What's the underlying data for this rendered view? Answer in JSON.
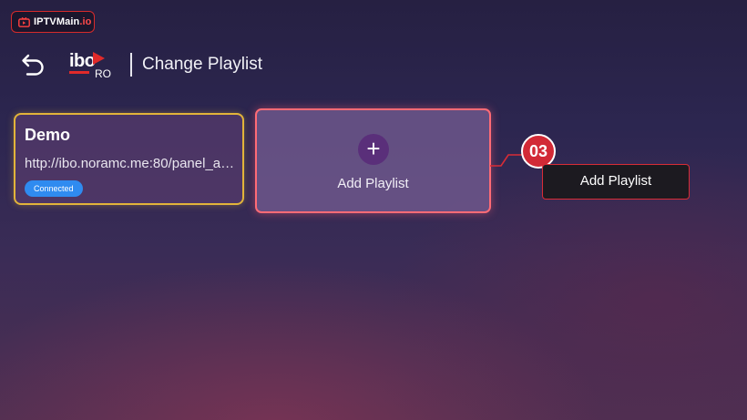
{
  "watermark": {
    "brand": "IPTVMain",
    "suffix": ".io"
  },
  "header": {
    "title": "Change Playlist",
    "logo_text": "ibo",
    "logo_sub": "RO"
  },
  "playlists": [
    {
      "name": "Demo",
      "url": "http://ibo.noramc.me:80/panel_api.php",
      "status": "Connected"
    }
  ],
  "add_card": {
    "label": "Add Playlist",
    "icon": "plus-icon"
  },
  "annotation": {
    "step": "03",
    "callout": "Add Playlist"
  },
  "colors": {
    "selected_border": "#e2b43a",
    "focus_border": "#ff6b76",
    "badge_blue": "#2f8bf0",
    "accent_red": "#d22a36"
  }
}
